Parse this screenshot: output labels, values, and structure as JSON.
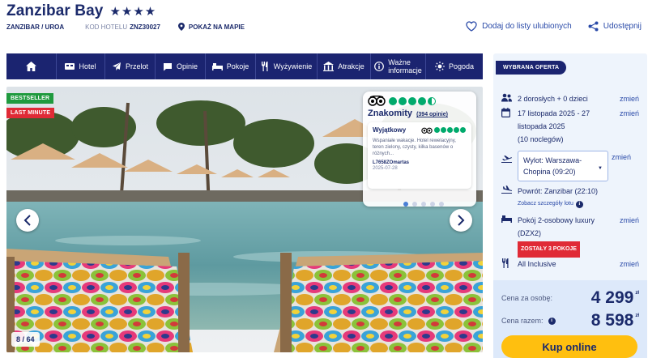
{
  "header": {
    "hotel_name": "Zanzibar Bay",
    "stars": "★★★★",
    "location": "ZANZIBAR / UROA",
    "code_label": "KOD HOTELU",
    "code_value": "ZNZ30027",
    "map_link": "POKAŻ NA MAPIE",
    "favorite_label": "Dodaj do listy ulubionych",
    "share_label": "Udostępnij"
  },
  "nav": {
    "items": [
      {
        "label": "",
        "icon": "home-icon"
      },
      {
        "label": "Hotel",
        "icon": "hotel-icon"
      },
      {
        "label": "Przelot",
        "icon": "plane-icon"
      },
      {
        "label": "Opinie",
        "icon": "chat-icon"
      },
      {
        "label": "Pokoje",
        "icon": "bed-icon"
      },
      {
        "label": "Wyżywienie",
        "icon": "cutlery-icon"
      },
      {
        "label": "Atrakcje",
        "icon": "attraction-icon"
      },
      {
        "label_line1": "Ważne",
        "label_line2": "informacje",
        "icon": "info-icon"
      },
      {
        "label": "Pogoda",
        "icon": "sun-icon"
      }
    ]
  },
  "gallery": {
    "badge_bestseller": "BESTSELLER",
    "badge_last_minute": "LAST MINUTE",
    "counter": "8 / 64",
    "slide_index": 8,
    "slide_total": 64
  },
  "tripadvisor": {
    "rating_text": "Znakomity",
    "reviews_count": "(394 opinie)",
    "bubbles_value": 4.5,
    "review": {
      "title": "Wyjątkowy",
      "bubbles_value": 5,
      "text": "Wspaniałe wakacje. Hotel rewelacyjny, teren zielony, czysty, kilka basenów o różnych...",
      "author": "L7658ZOmartas",
      "date": "2025-07-28"
    }
  },
  "offer": {
    "tag": "WYBRANA OFERTA",
    "guests": "2 dorosłych + 0 dzieci",
    "dates_line1": "17 listopada 2025 - 27",
    "dates_line2": "listopada 2025",
    "nights": "(10 noclegów)",
    "departure_line1": "Wylot: Warszawa-",
    "departure_line2": "Chopina (09:20)",
    "return": "Powrót: Zanzibar (22:10)",
    "flight_details_link": "Zobacz szczegóły lotu",
    "room_line1": "Pokój 2-osobowy luxury",
    "room_line2": "(DZX2)",
    "rooms_left": "ZOSTAŁY 3 POKOJE",
    "board": "All Inclusive",
    "change_label": "zmień",
    "price_per_person_label": "Cena za osobę:",
    "price_per_person": "4 299",
    "price_total_label": "Cena razem:",
    "price_total": "8 598",
    "currency": "zł",
    "buy_label": "Kup online"
  },
  "colors": {
    "navy": "#1b2470",
    "green_badge": "#1f9a3e",
    "red_badge": "#e02a36",
    "cta": "#ffbf0f",
    "tripadvisor_green": "#00aa6c"
  }
}
